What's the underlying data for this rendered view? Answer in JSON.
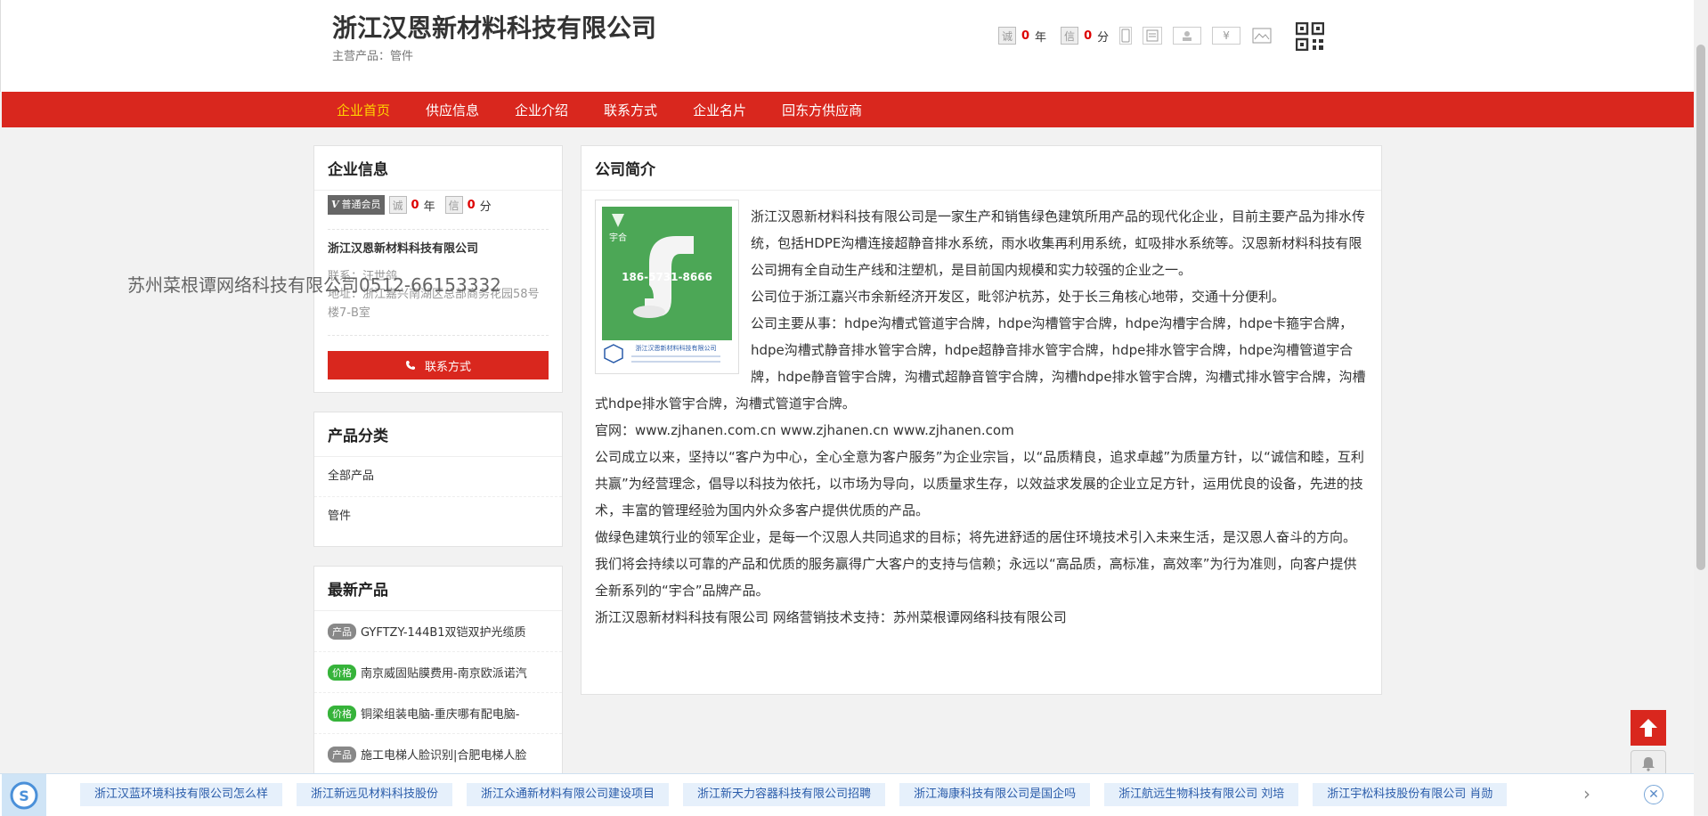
{
  "header": {
    "company_name": "浙江汉恩新材料科技有限公司",
    "main_product": "主营产品：管件",
    "cheng_icon": "诚",
    "years": "0",
    "year_unit": "年",
    "score_icon": "信",
    "score": "0",
    "score_unit": "分",
    "yen_icon": "¥"
  },
  "nav": {
    "items": [
      {
        "label": "企业首页"
      },
      {
        "label": "供应信息"
      },
      {
        "label": "企业介绍"
      },
      {
        "label": "联系方式"
      },
      {
        "label": "企业名片"
      },
      {
        "label": "回东方供应商"
      }
    ]
  },
  "info_panel": {
    "title": "企业信息",
    "vip_mark": "V",
    "member_type": "普通会员",
    "cheng_icon": "诚",
    "years": "0",
    "year_unit": "年",
    "score_icon": "信",
    "score": "0",
    "score_unit": "分",
    "company": "浙江汉恩新材料科技有限公司",
    "contact": "联系：汪世鸽",
    "address": "地址：浙江嘉兴南湖区总部商务花园58号楼7-B室",
    "contact_button": "联系方式"
  },
  "category_panel": {
    "title": "产品分类",
    "items": [
      {
        "label": "全部产品"
      },
      {
        "label": "管件"
      }
    ]
  },
  "new_panel": {
    "title": "最新产品",
    "items": [
      {
        "tag": "产品",
        "text": "GYFTZY-144B1双铠双护光缆质"
      },
      {
        "tag": "价格",
        "text": "南京威固贴膜费用-南京欧派诺汽"
      },
      {
        "tag": "价格",
        "text": "铜梁组装电脑-重庆哪有配电脑-"
      },
      {
        "tag": "产品",
        "text": "施工电梯人脸识别|合肥电梯人脸"
      }
    ]
  },
  "intro_panel": {
    "title": "公司简介",
    "image_phone": "186-5731-8666",
    "image_brand": "宇合",
    "image_company": "浙江汉恩新材料科技有限公司",
    "paragraphs": [
      "浙江汉恩新材料科技有限公司是一家生产和销售绿色建筑所用产品的现代化企业，目前主要产品为排水传统，包括HDPE沟槽连接超静音排水系统，雨水收集再利用系统，虹吸排水系统等。汉恩新材料科技有限公司拥有全自动生产线和注塑机，是目前国内规模和实力较强的企业之一。",
      "公司位于浙江嘉兴市余新经济开发区，毗邻沪杭苏，处于长三角核心地带，交通十分便利。",
      "公司主要从事：hdpe沟槽式管道宇合牌，hdpe沟槽管宇合牌，hdpe沟槽宇合牌，hdpe卡箍宇合牌，hdpe沟槽式静音排水管宇合牌，hdpe超静音排水管宇合牌，hdpe排水管宇合牌，hdpe沟槽管道宇合牌，hdpe静音管宇合牌，沟槽式超静音管宇合牌，沟槽hdpe排水管宇合牌，沟槽式排水管宇合牌，沟槽式hdpe排水管宇合牌，沟槽式管道宇合牌。",
      "官网：www.zjhanen.com.cn www.zjhanen.cn www.zjhanen.com",
      "公司成立以来，坚持以“客户为中心，全心全意为客户服务”为企业宗旨，以“品质精良，追求卓越”为质量方针，以“诚信和睦，互利共赢”为经营理念，倡导以科技为依托，以市场为导向，以质量求生存，以效益求发展的企业立足方针，运用优良的设备，先进的技术，丰富的管理经验为国内外众多客户提供优质的产品。",
      "做绿色建筑行业的领军企业，是每一个汉恩人共同追求的目标；将先进舒适的居住环境技术引入未来生活，是汉恩人奋斗的方向。我们将会持续以可靠的产品和优质的服务赢得广大客户的支持与信赖；永远以“高品质，高标准，高效率”为行为准则，向客户提供全新系列的“宇合”品牌产品。",
      "浙江汉恩新材料科技有限公司 网络营销技术支持：苏州菜根谭网络科技有限公司"
    ]
  },
  "watermark": "苏州菜根谭网络科技有限公司0512-66153332",
  "bottom_bar": {
    "links": [
      {
        "label": "浙江汉蓝环境科技有限公司怎么样"
      },
      {
        "label": "浙江新远见材料科技股份"
      },
      {
        "label": "浙江众通新材料有限公司建设项目"
      },
      {
        "label": "浙江新天力容器科技有限公司招聘"
      },
      {
        "label": "浙江海康科技有限公司是国企吗"
      },
      {
        "label": "浙江航远生物科技有限公司 刘培"
      },
      {
        "label": "浙江宇松科技股份有限公司 肖勋"
      }
    ],
    "arrow": "›",
    "close": "✕"
  },
  "colors": {
    "brand_red": "#d9271e",
    "nav_active": "#ffd400",
    "accent_num": "#dd0000",
    "link_blue": "#2a5caa"
  }
}
